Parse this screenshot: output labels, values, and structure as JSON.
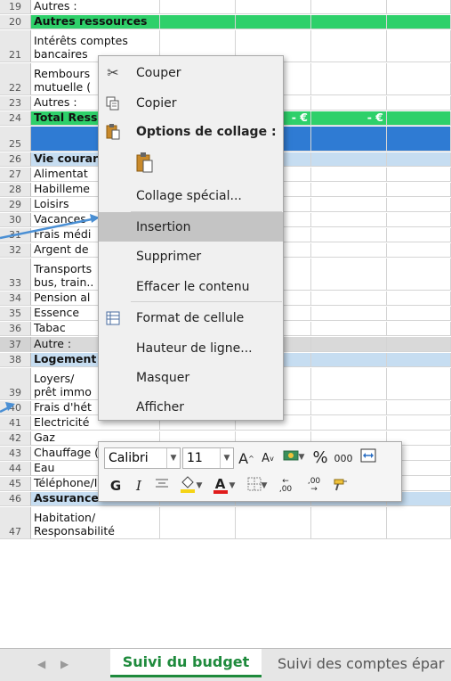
{
  "rows": [
    {
      "num": "19",
      "a": [
        "Autres :"
      ],
      "style": "",
      "h": 16
    },
    {
      "num": "20",
      "a": [
        "Autres ressources"
      ],
      "style": "green",
      "bold": true,
      "h": 16
    },
    {
      "num": "21",
      "a": [
        "Intérêts comptes",
        "bancaires"
      ],
      "style": "",
      "h": 36
    },
    {
      "num": "22",
      "a": [
        "Rembours",
        "mutuelle ("
      ],
      "style": "",
      "h": 36
    },
    {
      "num": "23",
      "a": [
        "Autres :"
      ],
      "style": "",
      "h": 16
    },
    {
      "num": "24",
      "a": [
        "Total Ress"
      ],
      "style": "green",
      "bold": true,
      "h": 16,
      "tot": [
        "€",
        "-   €",
        "-   €"
      ]
    },
    {
      "num": "25",
      "a": [
        ""
      ],
      "style": "blue",
      "h": 28
    },
    {
      "num": "26",
      "a": [
        "Vie courar"
      ],
      "style": "lightblue",
      "bold": true,
      "h": 16
    },
    {
      "num": "27",
      "a": [
        "Alimentat"
      ],
      "style": "",
      "h": 16
    },
    {
      "num": "28",
      "a": [
        "Habilleme"
      ],
      "style": "",
      "h": 16
    },
    {
      "num": "29",
      "a": [
        "Loisirs"
      ],
      "style": "",
      "h": 16
    },
    {
      "num": "30",
      "a": [
        "Vacances"
      ],
      "style": "",
      "h": 16
    },
    {
      "num": "31",
      "a": [
        "Frais médi"
      ],
      "style": "",
      "h": 16
    },
    {
      "num": "32",
      "a": [
        "Argent de"
      ],
      "style": "",
      "h": 16
    },
    {
      "num": "33",
      "a": [
        "Transports",
        "bus, train.."
      ],
      "style": "",
      "h": 36
    },
    {
      "num": "34",
      "a": [
        "Pension al"
      ],
      "style": "",
      "h": 16
    },
    {
      "num": "35",
      "a": [
        "Essence"
      ],
      "style": "",
      "h": 16
    },
    {
      "num": "36",
      "a": [
        "Tabac"
      ],
      "style": "",
      "h": 16
    },
    {
      "num": "37",
      "a": [
        "Autre :"
      ],
      "style": "gray",
      "h": 17,
      "sel": true
    },
    {
      "num": "38",
      "a": [
        "Logement"
      ],
      "style": "lightblue",
      "bold": true,
      "h": 16
    },
    {
      "num": "39",
      "a": [
        "Loyers/",
        "prêt immo"
      ],
      "style": "",
      "h": 36
    },
    {
      "num": "40",
      "a": [
        "Frais d'hét"
      ],
      "style": "",
      "h": 16
    },
    {
      "num": "41",
      "a": [
        "Electricité"
      ],
      "style": "",
      "h": 16
    },
    {
      "num": "42",
      "a": [
        "Gaz"
      ],
      "style": "",
      "h": 16
    },
    {
      "num": "43",
      "a": [
        "Chauffage (autre)"
      ],
      "style": "",
      "h": 16
    },
    {
      "num": "44",
      "a": [
        "Eau"
      ],
      "style": "",
      "h": 16
    },
    {
      "num": "45",
      "a": [
        "Téléphone/Internet"
      ],
      "style": "",
      "h": 16
    },
    {
      "num": "46",
      "a": [
        "Assurances"
      ],
      "style": "lightblue",
      "bold": true,
      "h": 16
    },
    {
      "num": "47",
      "a": [
        "Habitation/",
        "Responsabilité"
      ],
      "style": "",
      "h": 36
    }
  ],
  "context_menu": {
    "cut": "Couper",
    "copy": "Copier",
    "paste_options": "Options de collage :",
    "paste_special": "Collage spécial...",
    "insert": "Insertion",
    "delete": "Supprimer",
    "clear": "Effacer le contenu",
    "format": "Format de cellule",
    "row_height": "Hauteur de ligne...",
    "hide": "Masquer",
    "unhide": "Afficher"
  },
  "mini_toolbar": {
    "font": "Calibri",
    "size": "11",
    "grow": "A",
    "shrink": "A",
    "percent": "%",
    "thousands": "000",
    "bold": "G",
    "italic": "I",
    "font_color": "A",
    "inc_decimal": ",00",
    "dec_decimal": ",00"
  },
  "tabs": {
    "active": "Suivi du budget",
    "second": "Suivi des comptes épar"
  },
  "colors": {
    "green": "#2ed06a",
    "light_blue": "#c6ddf1",
    "blue": "#2f7bd3",
    "highlight": "#c4c4c4",
    "tab_green": "#1e8a3c"
  }
}
